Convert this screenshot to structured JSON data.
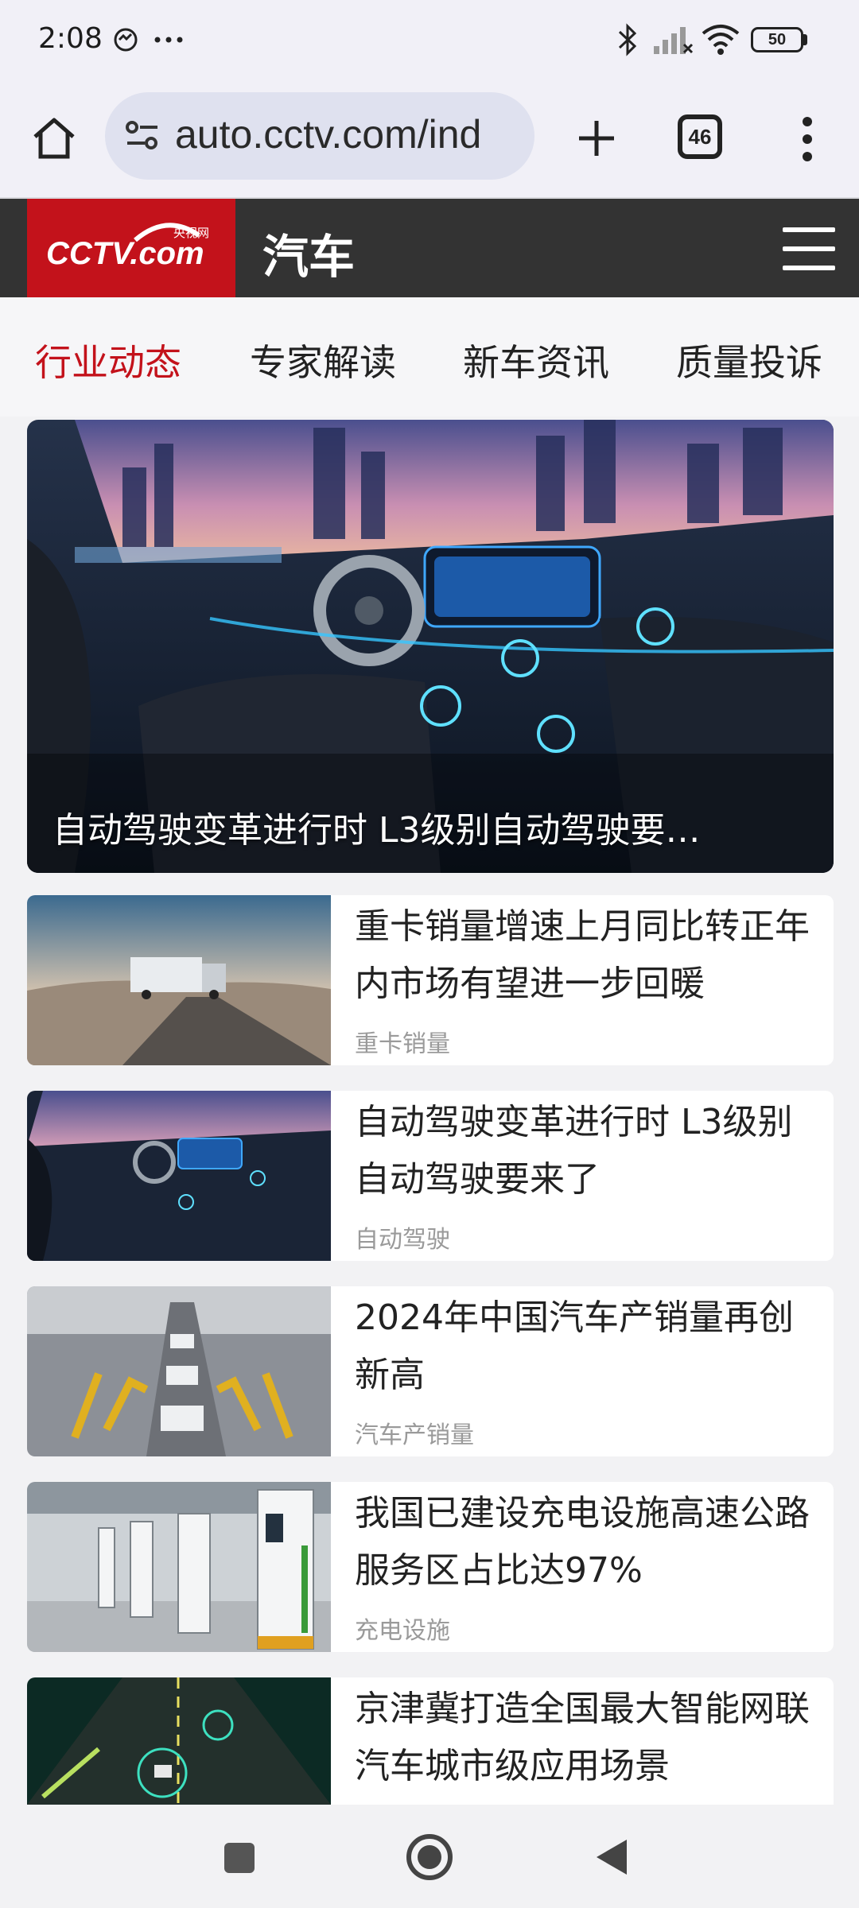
{
  "status_bar": {
    "time": "2:08",
    "battery": "50",
    "icons": [
      "sync-icon",
      "more-dots-icon",
      "bluetooth-icon",
      "signal-icon",
      "wifi-icon",
      "battery-icon"
    ]
  },
  "browser": {
    "url": "auto.cctv.com/ind",
    "tab_count": "46",
    "icons": [
      "home-icon",
      "site-settings-icon",
      "new-tab-icon",
      "tabs-icon",
      "menu-icon"
    ]
  },
  "header": {
    "logo_text": "CCTV.com",
    "logo_sub": "央视网",
    "section_title": "汽车"
  },
  "nav_tabs": [
    {
      "label": "行业动态",
      "active": true
    },
    {
      "label": "专家解读",
      "active": false
    },
    {
      "label": "新车资讯",
      "active": false
    },
    {
      "label": "质量投诉",
      "active": false
    }
  ],
  "hero": {
    "caption": "自动驾驶变革进行时 L3级别自动驾驶要…"
  },
  "articles": [
    {
      "title": "重卡销量增速上月同比转正年内市场有望进一步回暖",
      "tag": "重卡销量"
    },
    {
      "title": "自动驾驶变革进行时 L3级别自动驾驶要来了",
      "tag": "自动驾驶"
    },
    {
      "title": "2024年中国汽车产销量再创新高",
      "tag": "汽车产销量"
    },
    {
      "title": "我国已建设充电设施高速公路服务区占比达97%",
      "tag": "充电设施"
    },
    {
      "title": "京津冀打造全国最大智能网联汽车城市级应用场景",
      "tag": ""
    }
  ],
  "colors": {
    "brand_red": "#c3121b",
    "header_bg": "#333333",
    "tag_gray": "#9a9a9a"
  }
}
